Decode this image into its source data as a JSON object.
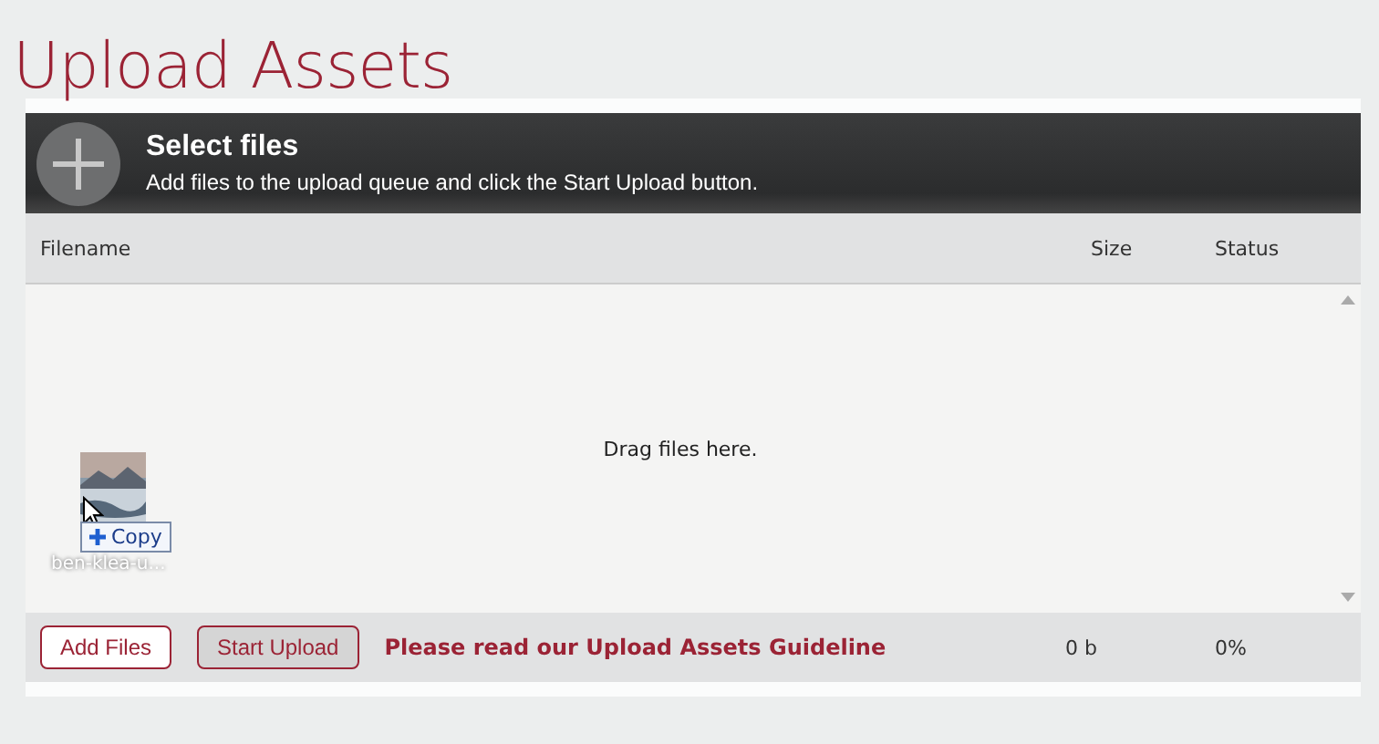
{
  "title": "Upload Assets",
  "header": {
    "title": "Select files",
    "subtitle": "Add files to the upload queue and click the Start Upload button."
  },
  "table": {
    "columns": [
      "Filename",
      "Size",
      "Status"
    ],
    "empty_text": "Drag files here."
  },
  "drag_ghost": {
    "filename": "ben-klea-u...",
    "action": "Copy"
  },
  "footer": {
    "buttons": [
      {
        "label": "Add Files",
        "kind": "primary"
      },
      {
        "label": "Start Upload",
        "kind": "secondary"
      }
    ],
    "link": "Please read our Upload Assets Guideline",
    "size": "0 b",
    "status": "0%"
  }
}
